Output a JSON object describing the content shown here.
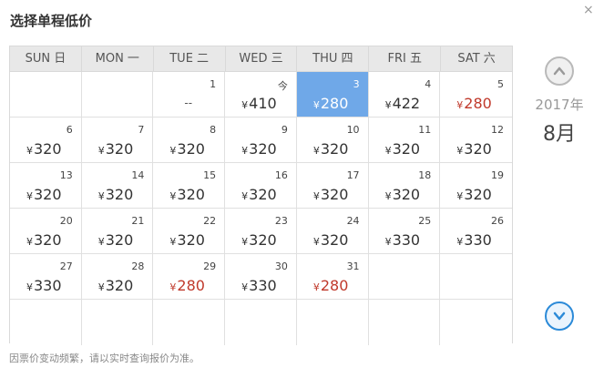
{
  "dialog": {
    "title": "选择单程低价",
    "close": "×",
    "note": "因票价变动频繁，请以实时查询报价为准。"
  },
  "calendar": {
    "weekdays": [
      "SUN 日",
      "MON 一",
      "TUE 二",
      "WED 三",
      "THU 四",
      "FRI 五",
      "SAT 六"
    ],
    "currency": "¥",
    "cells": [
      {
        "day": "",
        "price": ""
      },
      {
        "day": "",
        "price": ""
      },
      {
        "day": "1",
        "price": "--",
        "type": "dash"
      },
      {
        "day": "今",
        "price": "410"
      },
      {
        "day": "3",
        "price": "280",
        "selected": true
      },
      {
        "day": "4",
        "price": "422"
      },
      {
        "day": "5",
        "price": "280",
        "low": true
      },
      {
        "day": "6",
        "price": "320"
      },
      {
        "day": "7",
        "price": "320"
      },
      {
        "day": "8",
        "price": "320"
      },
      {
        "day": "9",
        "price": "320"
      },
      {
        "day": "10",
        "price": "320"
      },
      {
        "day": "11",
        "price": "320"
      },
      {
        "day": "12",
        "price": "320"
      },
      {
        "day": "13",
        "price": "320"
      },
      {
        "day": "14",
        "price": "320"
      },
      {
        "day": "15",
        "price": "320"
      },
      {
        "day": "16",
        "price": "320"
      },
      {
        "day": "17",
        "price": "320"
      },
      {
        "day": "18",
        "price": "320"
      },
      {
        "day": "19",
        "price": "320"
      },
      {
        "day": "20",
        "price": "320"
      },
      {
        "day": "21",
        "price": "320"
      },
      {
        "day": "22",
        "price": "320"
      },
      {
        "day": "23",
        "price": "320"
      },
      {
        "day": "24",
        "price": "320"
      },
      {
        "day": "25",
        "price": "330"
      },
      {
        "day": "26",
        "price": "330"
      },
      {
        "day": "27",
        "price": "330"
      },
      {
        "day": "28",
        "price": "320"
      },
      {
        "day": "29",
        "price": "280",
        "low": true
      },
      {
        "day": "30",
        "price": "330"
      },
      {
        "day": "31",
        "price": "280",
        "low": true
      },
      {
        "day": "",
        "price": ""
      },
      {
        "day": "",
        "price": ""
      },
      {
        "day": "",
        "price": ""
      },
      {
        "day": "",
        "price": ""
      },
      {
        "day": "",
        "price": ""
      },
      {
        "day": "",
        "price": ""
      },
      {
        "day": "",
        "price": ""
      },
      {
        "day": "",
        "price": ""
      },
      {
        "day": "",
        "price": ""
      }
    ]
  },
  "side": {
    "year": "2017年",
    "month": "8月",
    "prev_icon": "chevron-up-icon",
    "next_icon": "chevron-down-icon"
  },
  "colors": {
    "selected": "#6fa8e8",
    "low_price": "#c0392b",
    "next_button": "#2b8ad8"
  }
}
